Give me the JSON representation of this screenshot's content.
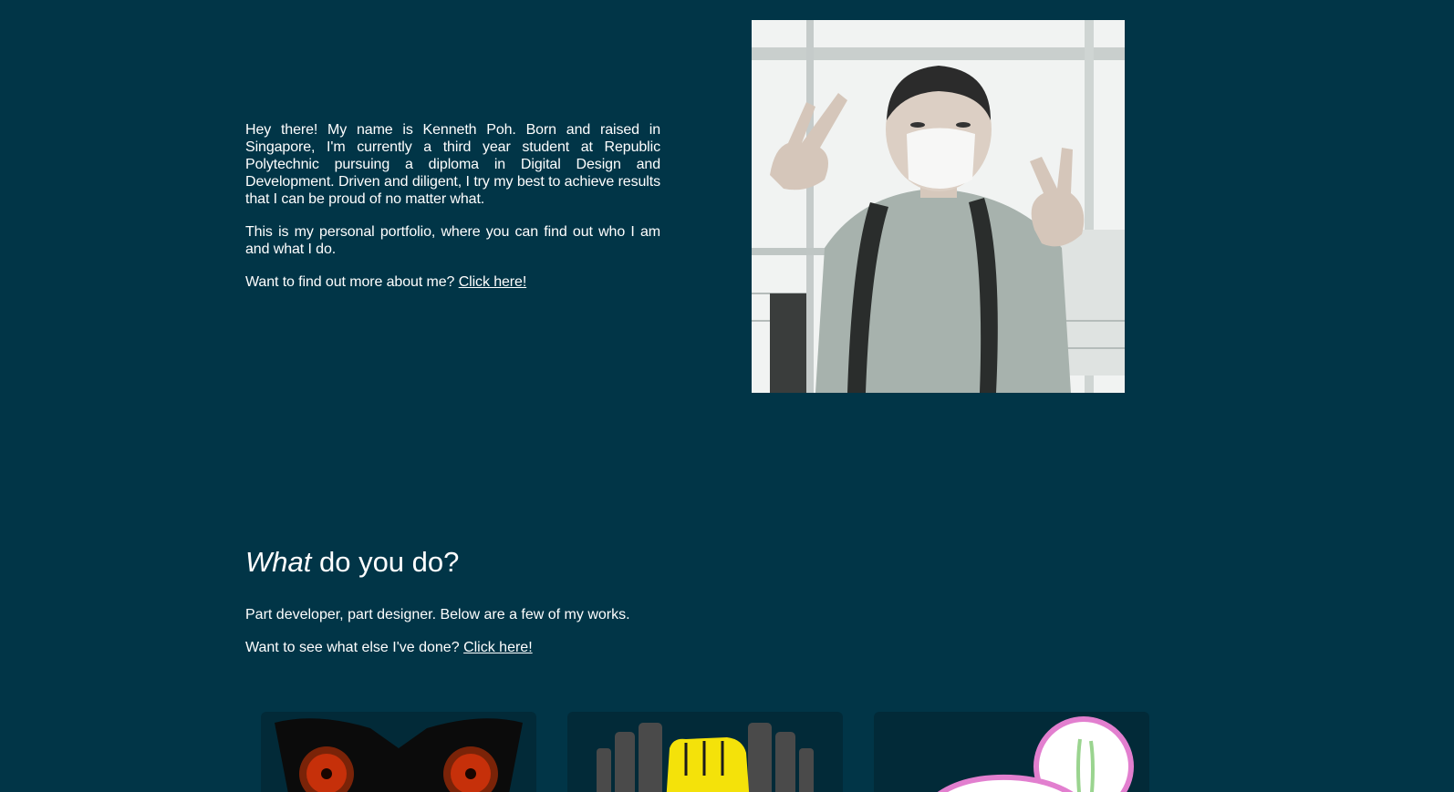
{
  "intro": {
    "paragraph1": "Hey there! My name is Kenneth Poh. Born and raised in Singapore, I'm currently a third year student at Republic Polytechnic pursuing a diploma in Digital Design and Development. Driven and diligent, I try my best to achieve results that I can be proud of no matter what.",
    "paragraph2": "This is my personal portfolio, where you can find out who I am and what I do.",
    "more_prompt": "Want to find out more about me?",
    "more_link": "Click here!"
  },
  "profile_photo": {
    "icon": "profile-photo"
  },
  "what_section": {
    "heading_emphasis": "What",
    "heading_rest": " do you do?",
    "description": "Part developer, part designer. Below are a few of my works.",
    "see_prompt": "Want to see what else I've done?",
    "see_link": "Click here!"
  },
  "colors": {
    "background": "#013547",
    "card_background": "#022a38",
    "text": "#ffffff"
  },
  "works": [
    {
      "icon": "owl-mask-logo"
    },
    {
      "icon": "fist-dumbbell-logo"
    },
    {
      "icon": "pink-character-logo"
    }
  ]
}
